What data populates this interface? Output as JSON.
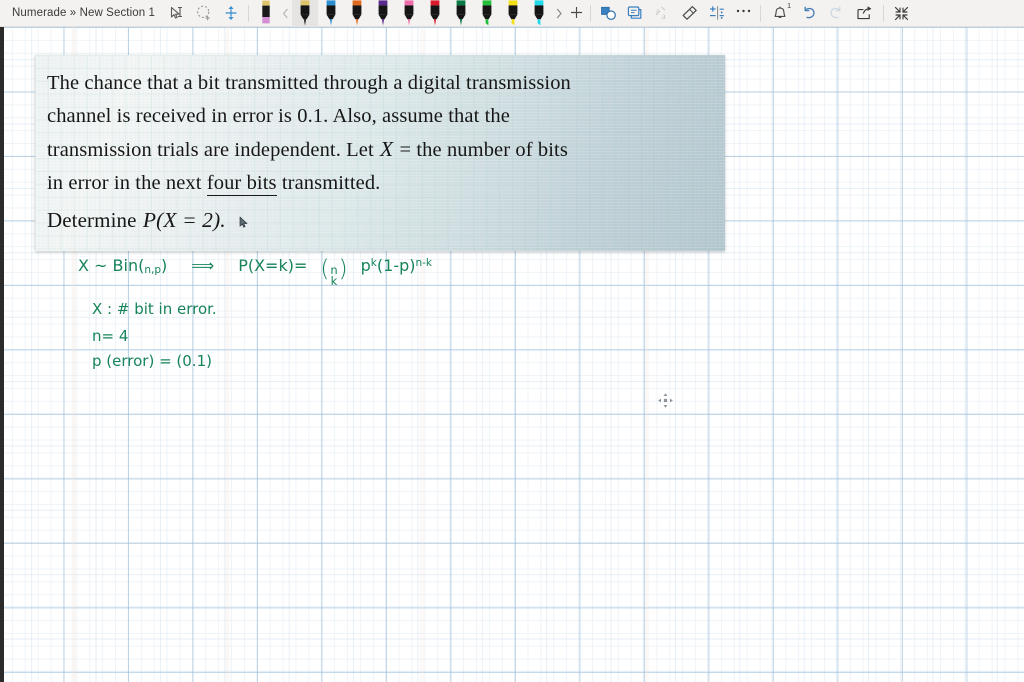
{
  "window": {
    "breadcrumb": "Numerade » New Section 1"
  },
  "toolbar": {
    "left_tools": [
      {
        "name": "select-tool",
        "label": "Select",
        "icon": "select-icon"
      },
      {
        "name": "lasso-select-tool",
        "label": "Lasso Select",
        "icon": "lasso-select-icon"
      },
      {
        "name": "insert-space-tool",
        "label": "Insert Space",
        "icon": "insert-space-icon"
      }
    ],
    "eraser": {
      "name": "eraser-tool",
      "label": "Eraser",
      "body": "#1a1a1a",
      "tip": "#d48fd4",
      "cap": "#e0c46a"
    },
    "prev_pens_label": "Previous pens",
    "next_pens_label": "More pens",
    "add_pen_label": "Add pen",
    "selected_pen_index": 0,
    "pens": [
      {
        "name": "pen-black",
        "label": "Black Pen",
        "color": "#1a1a1a",
        "cap": "#e0c46a",
        "selected": true
      },
      {
        "name": "pen-blue",
        "label": "Blue Pen",
        "color": "#2a8fd0",
        "cap": "#2a8fd0"
      },
      {
        "name": "pen-orange",
        "label": "Orange Pen",
        "color": "#e06a1b",
        "cap": "#e06a1b"
      },
      {
        "name": "pen-purple",
        "label": "Purple Pen",
        "color": "#5a2a8f",
        "cap": "#5a2a8f"
      },
      {
        "name": "pen-pink",
        "label": "Pink Pen",
        "color": "#ef6aa8",
        "cap": "#ef6aa8"
      },
      {
        "name": "pen-red",
        "label": "Red Pen",
        "color": "#d81a2a",
        "cap": "#d81a2a"
      },
      {
        "name": "pen-green",
        "label": "Green Pen",
        "color": "#0a7a45",
        "cap": "#0a7a45"
      },
      {
        "name": "highlighter-green",
        "label": "Green Highlighter",
        "color": "#22c03a",
        "cap": "#22c03a",
        "highlighter": true
      },
      {
        "name": "highlighter-yellow",
        "label": "Yellow Highlighter",
        "color": "#f2e014",
        "cap": "#f2e014",
        "highlighter": true
      },
      {
        "name": "highlighter-cyan",
        "label": "Cyan Highlighter",
        "color": "#1fd8e8",
        "cap": "#1fd8e8",
        "highlighter": true
      }
    ],
    "right_tools": [
      {
        "name": "ink-to-shape-tool",
        "label": "Ink to Shape",
        "icon": "ink-to-shape-icon",
        "enabled": true
      },
      {
        "name": "ink-to-math-tool",
        "label": "Ink to Math",
        "icon": "ink-to-math-icon",
        "enabled": true
      },
      {
        "name": "ink-to-text-tool",
        "label": "Ink to Text",
        "icon": "ink-to-text-icon",
        "enabled": false
      },
      {
        "name": "eraser-button",
        "label": "Eraser",
        "icon": "eraser-icon",
        "enabled": true
      },
      {
        "name": "math-button",
        "label": "Math",
        "icon": "math-icon",
        "enabled": true
      },
      {
        "name": "more-options",
        "label": "More Options",
        "icon": "ellipsis-icon",
        "enabled": true
      }
    ],
    "notifications": {
      "name": "notifications-button",
      "label": "Notifications",
      "badge": "1"
    },
    "undo": {
      "name": "undo-button",
      "label": "Undo",
      "enabled": true
    },
    "redo": {
      "name": "redo-button",
      "label": "Redo",
      "enabled": false
    },
    "share": {
      "name": "share-button",
      "label": "Share"
    },
    "collapse": {
      "name": "collapse-ribbon-button",
      "label": "Collapse Ribbon"
    }
  },
  "printed_block": {
    "line1": "The chance that a bit transmitted through a digital transmission",
    "line2": "channel is received in error is 0.1. Also, assume that the",
    "line3_a": "transmission trials are independent. Let",
    "line3_var": "X",
    "line3_b": "= the number of bits",
    "line4_a": "in error in the next",
    "line4_underlined": "four bits",
    "line4_b": "transmitted.",
    "line5_a": "Determine",
    "line5_expr": "P(X = 2).",
    "cursor": "arrow-cursor"
  },
  "ink_notes": {
    "line1": {
      "dist": "X ~ Bin(",
      "dist_sub": "n,p",
      "dist_close": ")",
      "arrow": "⟹",
      "pmf": "P(X=k)=",
      "binom_top": "n",
      "binom_bottom": "k",
      "term1": "p",
      "term1_sup": "k",
      "term2": "(1-p)",
      "term2_sup": "n-k"
    },
    "line2": "X : #   bit in error.",
    "line3": "n=   4",
    "line4": "p (error) = (0.1)"
  },
  "cursor_marker": "move-handle-icon",
  "colors": {
    "ribbon_bg": "#f3f2f1",
    "ink_green": "#17845a",
    "grid_blue": "#96b9d7",
    "printed_text": "#171717"
  }
}
